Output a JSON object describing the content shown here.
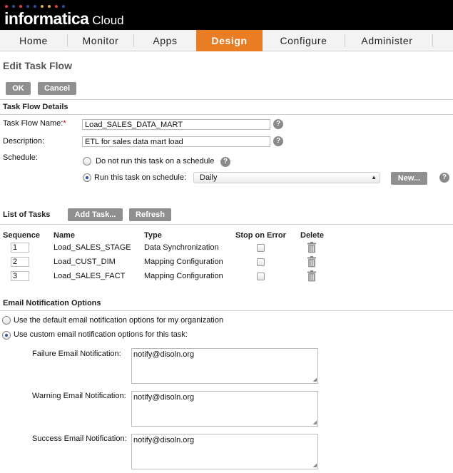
{
  "brand": {
    "name_bold": "informatica",
    "name_light": " Cloud",
    "dot_colors": [
      "#e33b3b",
      "#2f4fa1",
      "#e33b3b",
      "#2f4fa1",
      "#2f4fa1",
      "#e3b03b",
      "#e3b03b",
      "#e33b3b",
      "#2f4fa1"
    ]
  },
  "nav": {
    "items": [
      "Home",
      "Monitor",
      "Apps",
      "Design",
      "Configure",
      "Administer"
    ],
    "active": "Design",
    "accent_color": "#e97d23"
  },
  "page": {
    "title": "Edit Task Flow",
    "ok_label": "OK",
    "cancel_label": "Cancel"
  },
  "details": {
    "section_title": "Task Flow Details",
    "name_label": "Task Flow Name:",
    "required_mark": "*",
    "name_value": "Load_SALES_DATA_MART",
    "description_label": "Description:",
    "description_value": "ETL for sales data mart load",
    "schedule_label": "Schedule:",
    "no_schedule_label": "Do not run this task on a schedule",
    "run_schedule_label": "Run this task on schedule:",
    "schedule_selected": "Daily",
    "new_label": "New...",
    "help_glyph": "?"
  },
  "tasks": {
    "section_title": "List of Tasks",
    "add_task_label": "Add Task...",
    "refresh_label": "Refresh",
    "headers": [
      "Sequence",
      "Name",
      "Type",
      "Stop on Error",
      "Delete"
    ],
    "rows": [
      {
        "sequence": "1",
        "name": "Load_SALES_STAGE",
        "type": "Data Synchronization"
      },
      {
        "sequence": "2",
        "name": "Load_CUST_DIM",
        "type": "Mapping Configuration"
      },
      {
        "sequence": "3",
        "name": "Load_SALES_FACT",
        "type": "Mapping Configuration"
      }
    ]
  },
  "email": {
    "section_title": "Email Notification Options",
    "default_option": "Use the default email notification options for my organization",
    "custom_option": "Use custom email notification options for this task:",
    "failure_label": "Failure Email Notification:",
    "failure_value": "notify@disoln.org",
    "warning_label": "Warning Email Notification:",
    "warning_value": "notify@disoln.org",
    "success_label": "Success Email Notification:",
    "success_value": "notify@disoln.org"
  }
}
